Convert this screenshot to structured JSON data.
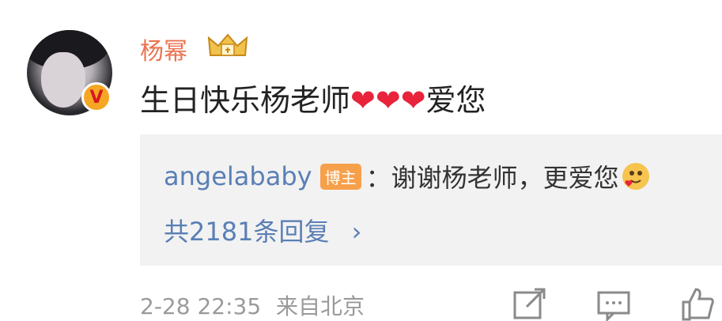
{
  "comment": {
    "username": "杨幂",
    "text_before": "生日快乐杨老师",
    "hearts": [
      "❤",
      "❤",
      "❤"
    ],
    "text_after": "爱您"
  },
  "reply": {
    "user": "angelababy",
    "tag": "博主",
    "separator": "：",
    "text": "谢谢杨老师，更爱您",
    "total": "共2181条回复",
    "chevron": "›"
  },
  "footer": {
    "datetime": "2-28 22:35",
    "location": "来自北京"
  },
  "icons": [
    "avatar",
    "verified-badge-icon",
    "crown-icon",
    "share-icon",
    "comment-icon",
    "like-icon"
  ],
  "colors": {
    "username": "#eb7350",
    "link": "#5a7fb5",
    "tag": "#f7a04b",
    "heart": "#e8233b",
    "meta": "#9a9a9a"
  }
}
